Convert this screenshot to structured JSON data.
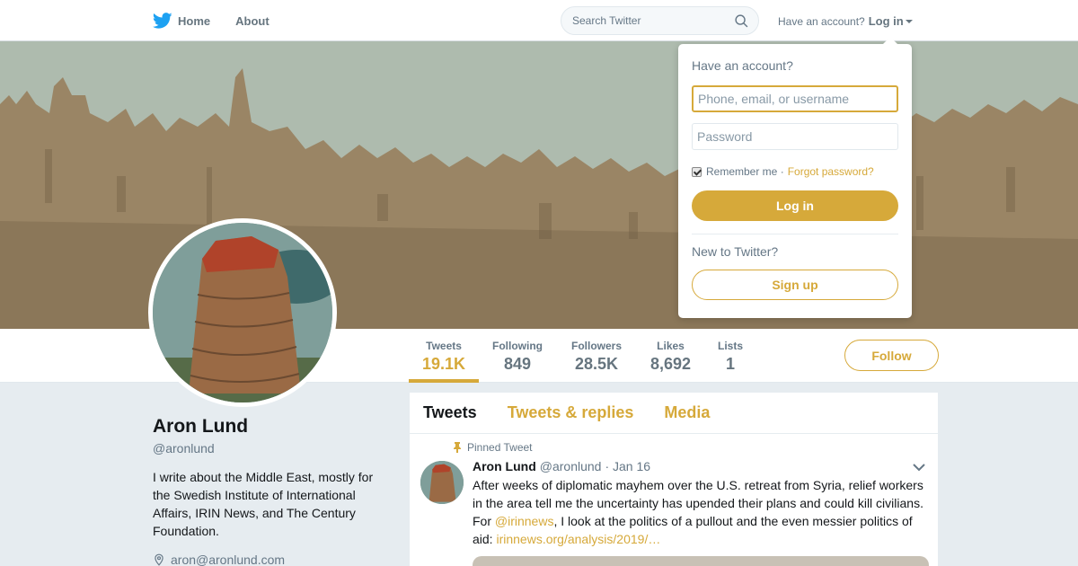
{
  "nav": {
    "home_label": "Home",
    "about_label": "About",
    "search_placeholder": "Search Twitter",
    "have_account": "Have an account?",
    "login_label": "Log in",
    "brand_color": "#d6a93a"
  },
  "profile": {
    "name": "Aron Lund",
    "handle": "@aronlund",
    "bio": "I write about the Middle East, mostly for the Swedish Institute of International Affairs, IRIN News, and The Century Foundation.",
    "location": "aron@aronlund.com"
  },
  "stats": [
    {
      "label": "Tweets",
      "value": "19.1K"
    },
    {
      "label": "Following",
      "value": "849"
    },
    {
      "label": "Followers",
      "value": "28.5K"
    },
    {
      "label": "Likes",
      "value": "8,692"
    },
    {
      "label": "Lists",
      "value": "1"
    }
  ],
  "follow_label": "Follow",
  "tabs": [
    "Tweets",
    "Tweets & replies",
    "Media"
  ],
  "tweet": {
    "pinned_label": "Pinned Tweet",
    "author": "Aron Lund",
    "handle": "@aronlund",
    "date": "· Jan 16",
    "text_1": "After weeks of diplomatic mayhem over the U.S. retreat from Syria, relief workers in the area tell me the uncertainty has upended their plans and could kill civilians. For ",
    "mention": "@irinnews",
    "text_2": ", I look at the politics of a pullout and the even messier politics of aid: ",
    "link": "irinnews.org/analysis/2019/…"
  },
  "login_dropdown": {
    "question": "Have an account?",
    "username_placeholder": "Phone, email, or username",
    "password_placeholder": "Password",
    "remember_label": "Remember me ·",
    "forgot_label": "Forgot password?",
    "login_button": "Log in",
    "new_label": "New to Twitter?",
    "signup_button": "Sign up"
  }
}
